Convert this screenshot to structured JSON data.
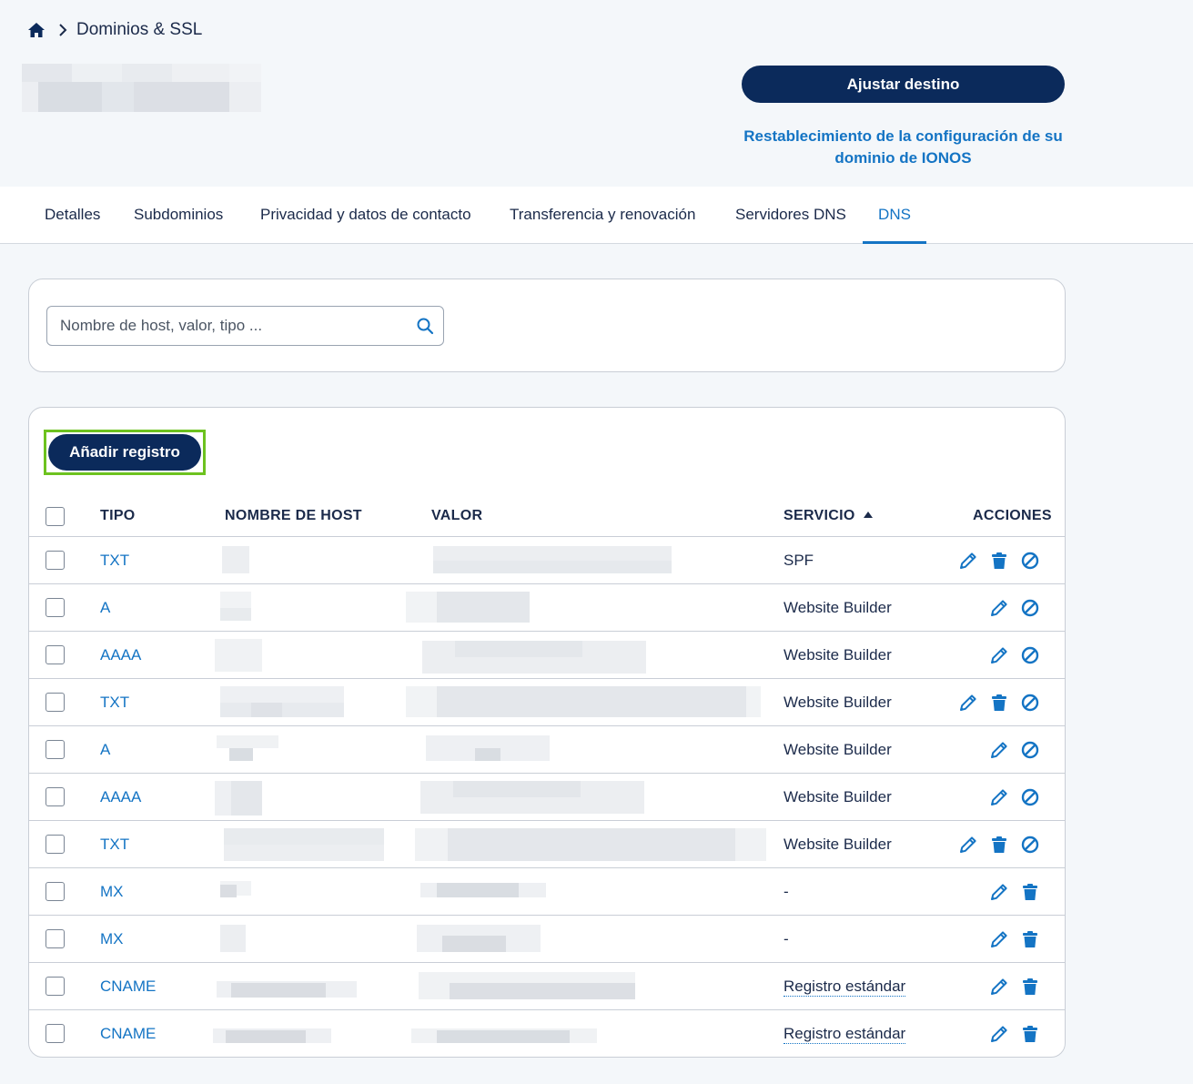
{
  "breadcrumb": {
    "home_icon": "home-icon",
    "separator_icon": "chevron-right-icon",
    "current": "Dominios & SSL"
  },
  "header": {
    "primary_button": "Ajustar destino",
    "reset_link": "Restablecimiento de la configuración de su dominio de IONOS"
  },
  "tabs": [
    {
      "label": "Detalles",
      "active": false
    },
    {
      "label": "Subdominios",
      "active": false
    },
    {
      "label": "Privacidad y datos de contacto",
      "active": false
    },
    {
      "label": "Transferencia y renovación",
      "active": false
    },
    {
      "label": "Servidores DNS",
      "active": false
    },
    {
      "label": "DNS",
      "active": true
    }
  ],
  "search": {
    "placeholder": "Nombre de host, valor, tipo ...",
    "value": "",
    "icon": "search-icon"
  },
  "table": {
    "add_button": "Añadir registro",
    "columns": {
      "type": "TIPO",
      "host": "NOMBRE DE HOST",
      "value": "VALOR",
      "service": "SERVICIO",
      "actions": "ACCIONES"
    },
    "sort": {
      "column": "SERVICIO",
      "direction": "ascending"
    },
    "rows": [
      {
        "type": "TXT",
        "service": "SPF",
        "service_link": false,
        "actions": [
          "edit",
          "delete",
          "deactivate"
        ]
      },
      {
        "type": "A",
        "service": "Website Builder",
        "service_link": false,
        "actions": [
          "edit",
          "deactivate"
        ]
      },
      {
        "type": "AAAA",
        "service": "Website Builder",
        "service_link": false,
        "actions": [
          "edit",
          "deactivate"
        ]
      },
      {
        "type": "TXT",
        "service": "Website Builder",
        "service_link": false,
        "actions": [
          "edit",
          "delete",
          "deactivate"
        ]
      },
      {
        "type": "A",
        "service": "Website Builder",
        "service_link": false,
        "actions": [
          "edit",
          "deactivate"
        ]
      },
      {
        "type": "AAAA",
        "service": "Website Builder",
        "service_link": false,
        "actions": [
          "edit",
          "deactivate"
        ]
      },
      {
        "type": "TXT",
        "service": "Website Builder",
        "service_link": false,
        "actions": [
          "edit",
          "delete",
          "deactivate"
        ]
      },
      {
        "type": "MX",
        "service": "-",
        "service_link": false,
        "actions": [
          "edit",
          "delete"
        ]
      },
      {
        "type": "MX",
        "service": "-",
        "service_link": false,
        "actions": [
          "edit",
          "delete"
        ]
      },
      {
        "type": "CNAME",
        "service": "Registro estándar",
        "service_link": true,
        "actions": [
          "edit",
          "delete"
        ]
      },
      {
        "type": "CNAME",
        "service": "Registro estándar",
        "service_link": true,
        "actions": [
          "edit",
          "delete"
        ]
      }
    ]
  },
  "colors": {
    "navy": "#0b2a5b",
    "link_blue": "#1474c4",
    "highlight_green": "#6dc21f",
    "background": "#f4f7fa"
  }
}
